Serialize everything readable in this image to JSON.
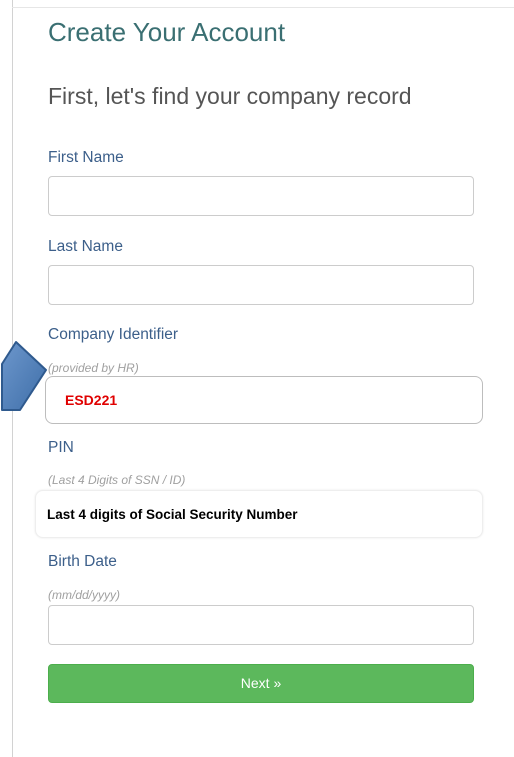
{
  "form": {
    "title": "Create Your Account",
    "subtitle": "First, let's find your company record",
    "first_name": {
      "label": "First Name",
      "value": ""
    },
    "last_name": {
      "label": "Last Name",
      "value": ""
    },
    "company_identifier": {
      "label": "Company Identifier",
      "hint": "(provided by HR)",
      "value": "ESD221"
    },
    "pin": {
      "label": "PIN",
      "hint": "(Last 4 Digits of SSN / ID)",
      "value": "Last 4 digits of Social Security Number"
    },
    "birth_date": {
      "label": "Birth Date",
      "hint": "(mm/dd/yyyy)",
      "value": ""
    },
    "next_button": "Next »"
  },
  "annotation": {
    "arrow_icon": "arrow-pointer-icon",
    "arrow_color": "#4a7ab8",
    "company_text_color": "#e00000",
    "pin_text_color": "#000000"
  }
}
